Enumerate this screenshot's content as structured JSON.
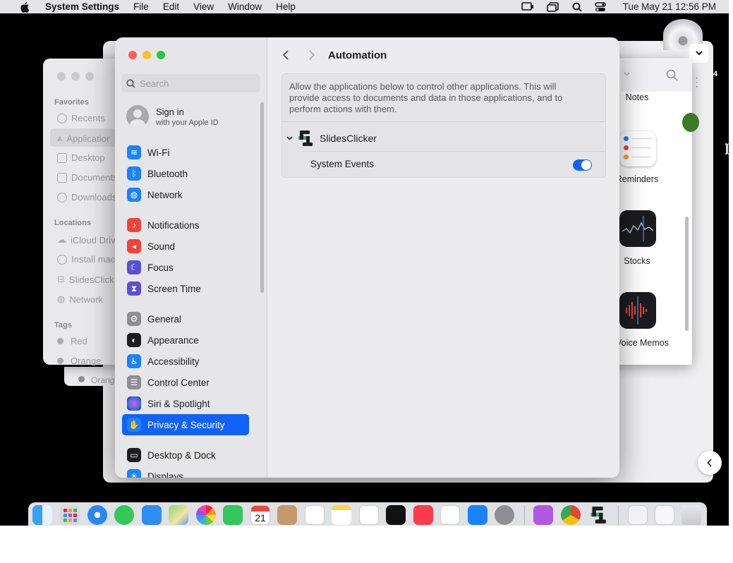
{
  "menubar": {
    "app_name": "System Settings",
    "items": [
      "File",
      "Edit",
      "View",
      "Window",
      "Help"
    ],
    "clock": "Tue May 21  12:56 PM"
  },
  "finder": {
    "favorites_header": "Favorites",
    "favorites": [
      "Recents",
      "Applications",
      "Desktop",
      "Documents",
      "Downloads"
    ],
    "locations_header": "Locations",
    "locations": [
      "iCloud Drive",
      "Install macOS",
      "SlidesClicker",
      "Network"
    ],
    "tags_header": "Tags",
    "tags": [
      "Red",
      "Orange"
    ],
    "apps": [
      "Notes",
      "Reminders",
      "Stocks",
      "Voice Memos"
    ]
  },
  "settings": {
    "search_placeholder": "Search",
    "signin_title": "Sign in",
    "signin_subtitle": "with your Apple ID",
    "sidebar": [
      {
        "label": "Wi-Fi",
        "color": "#1a82fb",
        "glyph": "≋"
      },
      {
        "label": "Bluetooth",
        "color": "#1a82fb",
        "glyph": "ᛒ"
      },
      {
        "label": "Network",
        "color": "#1a82fb",
        "glyph": "◍"
      },
      {
        "label": "Notifications",
        "color": "#f0443a",
        "glyph": "🔔"
      },
      {
        "label": "Sound",
        "color": "#f0443a",
        "glyph": "◂"
      },
      {
        "label": "Focus",
        "color": "#5b4fd6",
        "glyph": "☾"
      },
      {
        "label": "Screen Time",
        "color": "#5b4fd6",
        "glyph": "⧗"
      },
      {
        "label": "General",
        "color": "#8e8e93",
        "glyph": "⚙"
      },
      {
        "label": "Appearance",
        "color": "#1d1d1f",
        "glyph": "◐"
      },
      {
        "label": "Accessibility",
        "color": "#1a82fb",
        "glyph": "♿"
      },
      {
        "label": "Control Center",
        "color": "#8e8e93",
        "glyph": "☰"
      },
      {
        "label": "Siri & Spotlight",
        "color": "#b03fd0",
        "glyph": "●"
      },
      {
        "label": "Privacy & Security",
        "color": "#1a82fb",
        "glyph": "✋"
      },
      {
        "label": "Desktop & Dock",
        "color": "#1d1d1f",
        "glyph": "▭"
      },
      {
        "label": "Displays",
        "color": "#1a82fb",
        "glyph": "☀"
      }
    ],
    "pane_title": "Automation",
    "description": "Allow the applications below to control other applications. This will provide access to documents and data in those applications, and to perform actions with them.",
    "app_name": "SlidesClicker",
    "permission": "System Events",
    "permission_enabled": true
  }
}
